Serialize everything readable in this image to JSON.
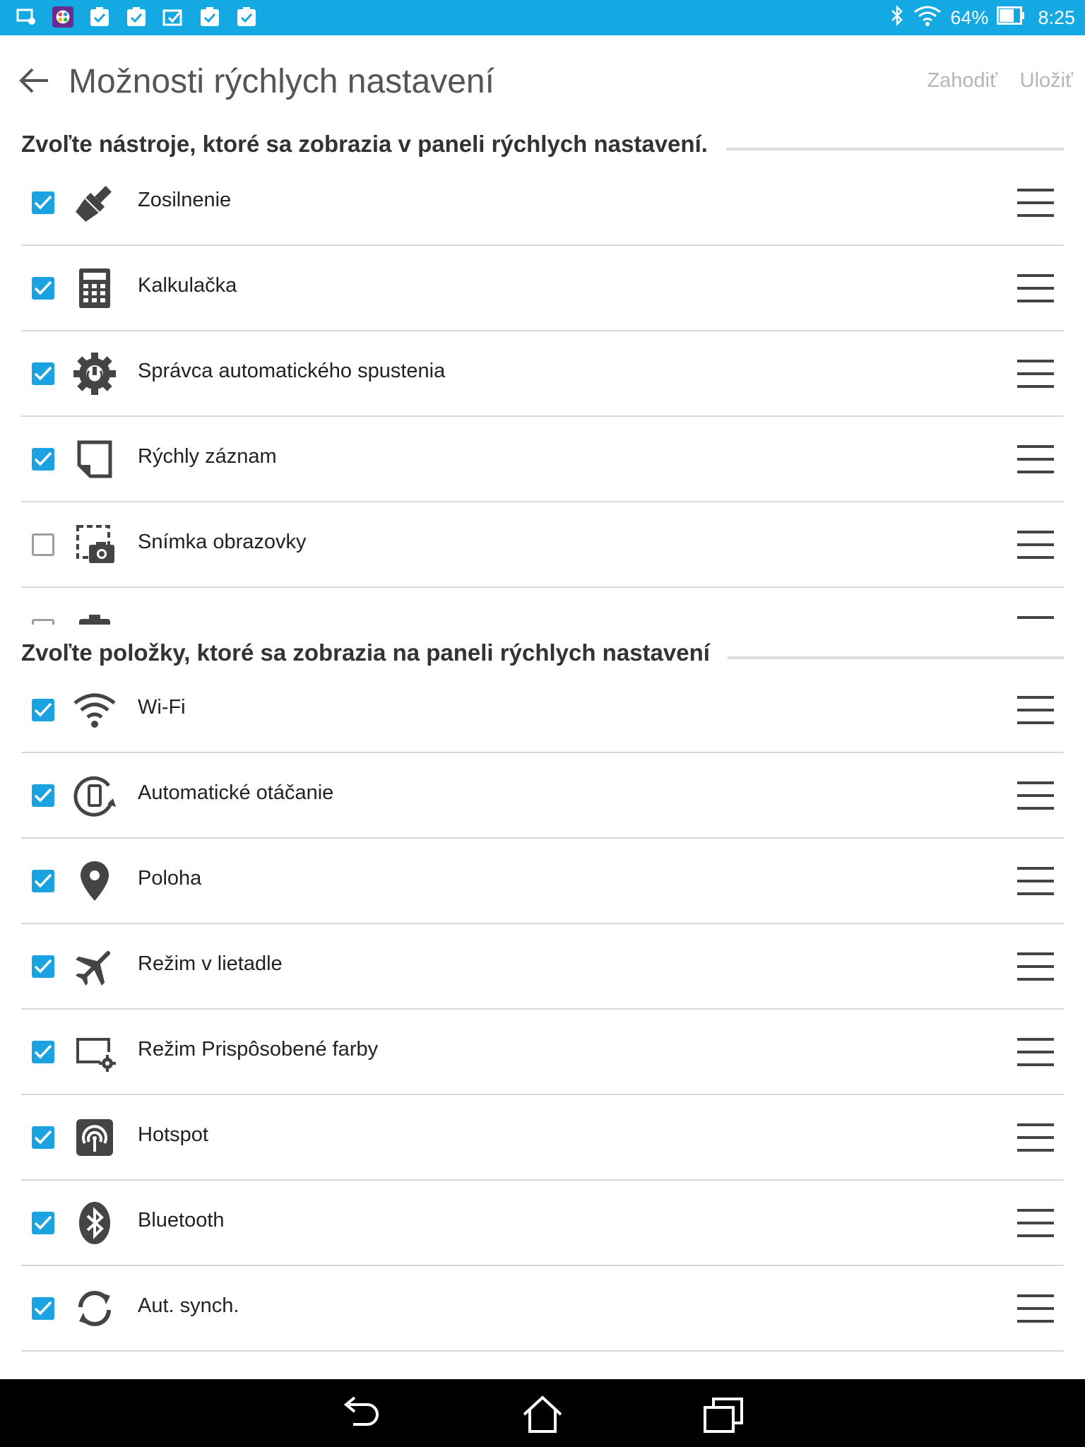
{
  "status_bar": {
    "battery": "64%",
    "time": "8:25",
    "left_icons": [
      "screen-record-icon",
      "color-palette-app-icon",
      "task-check-icon",
      "task-check-icon",
      "photo-check-icon",
      "task-check-icon",
      "task-check-icon"
    ],
    "right_icons": [
      "bluetooth-icon",
      "wifi-icon",
      "battery-icon"
    ]
  },
  "app_bar": {
    "title": "Možnosti rýchlych nastavení",
    "discard_label": "Zahodiť",
    "save_label": "Uložiť"
  },
  "tools_section": {
    "title": "Zvoľte nástroje, ktoré sa zobrazia v paneli rýchlych nastavení.",
    "items": [
      {
        "label": "Zosilnenie",
        "checked": true,
        "icon": "boost-brush-icon"
      },
      {
        "label": "Kalkulačka",
        "checked": true,
        "icon": "calculator-icon"
      },
      {
        "label": "Správca automatického spustenia",
        "checked": true,
        "icon": "autostart-gear-icon"
      },
      {
        "label": "Rýchly záznam",
        "checked": true,
        "icon": "quick-memo-icon"
      },
      {
        "label": "Snímka obrazovky",
        "checked": false,
        "icon": "screenshot-camera-icon"
      }
    ]
  },
  "settings_section": {
    "title": "Zvoľte položky, ktoré sa zobrazia na paneli rýchlych nastavení",
    "items": [
      {
        "label": "Wi-Fi",
        "checked": true,
        "icon": "wifi-icon"
      },
      {
        "label": "Automatické otáčanie",
        "checked": true,
        "icon": "auto-rotate-icon"
      },
      {
        "label": "Poloha",
        "checked": true,
        "icon": "location-pin-icon"
      },
      {
        "label": "Režim v lietadle",
        "checked": true,
        "icon": "airplane-icon"
      },
      {
        "label": "Režim Prispôsobené farby",
        "checked": true,
        "icon": "display-color-gear-icon"
      },
      {
        "label": "Hotspot",
        "checked": true,
        "icon": "hotspot-icon"
      },
      {
        "label": "Bluetooth",
        "checked": true,
        "icon": "bluetooth-icon"
      },
      {
        "label": "Aut. synch.",
        "checked": true,
        "icon": "sync-icon"
      }
    ]
  },
  "colors": {
    "status_bar": "#14a9e3",
    "checkbox_on": "#1aa3e0",
    "action_disabled": "#b5b5b5"
  }
}
